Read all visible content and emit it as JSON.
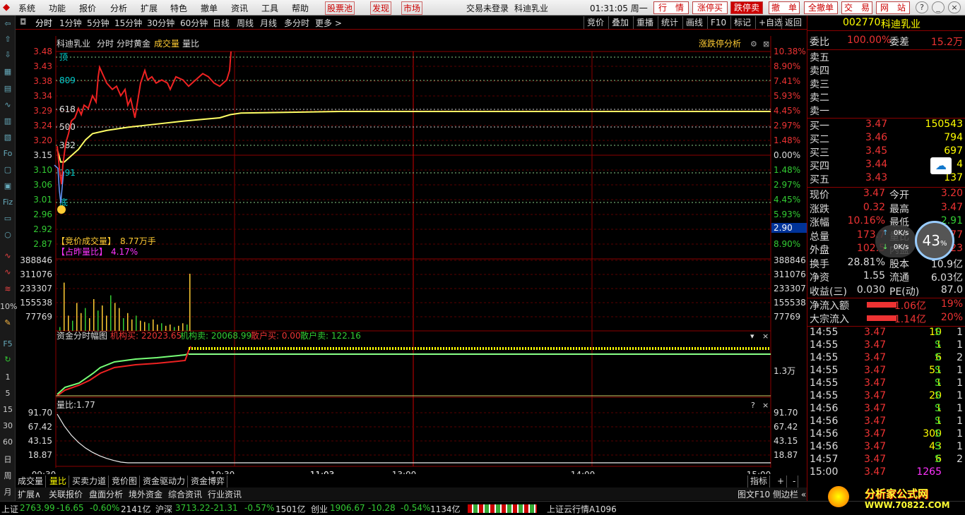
{
  "menu": [
    "系统",
    "功能",
    "报价",
    "分析",
    "扩展",
    "特色",
    "撤单",
    "资讯",
    "工具",
    "帮助"
  ],
  "menu_extra": {
    "pool": "股票池",
    "find": "发现",
    "market": "市场",
    "login": "交易未登录",
    "stock": "科迪乳业",
    "clock": "01:31:05 周一"
  },
  "top_buttons": [
    "行　情",
    "涨停买",
    "跌停卖",
    "撤　单",
    "全撤单",
    "交　易",
    "网　站"
  ],
  "win_buttons": [
    "?",
    "_",
    "□",
    "×"
  ],
  "period_tabs": [
    "分时",
    "1分钟",
    "5分钟",
    "15分钟",
    "30分钟",
    "60分钟",
    "日线",
    "周线",
    "月线",
    "多分时",
    "更多 >"
  ],
  "right_tabs": [
    "竞价",
    "叠加",
    "重播",
    "统计",
    "画线",
    "F10",
    "标记",
    "+自选",
    "返回"
  ],
  "header": {
    "name": "科迪乳业",
    "t1": "分时",
    "t2": "分时黄金",
    "t3": "成交量",
    "t4": "量比",
    "analysis": "涨跌停分析"
  },
  "left_tools": [
    "Fo",
    "Fiz",
    "10%",
    "F5",
    "1",
    "5",
    "15",
    "30",
    "60",
    "日",
    "周",
    "月"
  ],
  "price_axis": {
    "left": [
      "3.48",
      "3.43",
      "3.38",
      "3.34",
      "3.29",
      "3.24",
      "3.20",
      "3.15",
      "3.10",
      "3.06",
      "3.01",
      "2.96",
      "2.92",
      "2.87"
    ],
    "right": [
      "10.38%",
      "8.90%",
      "7.41%",
      "5.93%",
      "4.45%",
      "2.97%",
      "1.48%",
      "0.00%",
      "1.48%",
      "2.97%",
      "4.45%",
      "5.93%",
      "7.41%",
      "8.90%"
    ],
    "cursor": "2.90"
  },
  "price_labels": [
    "顶",
    "809",
    "618",
    "500",
    "382",
    "191",
    "底"
  ],
  "auction": {
    "l1": "【竞价成交量】",
    "v1": "8.77万手",
    "l2": "【占昨量比】",
    "v2": "4.17%"
  },
  "vol_axis": [
    "388846",
    "311076",
    "233307",
    "155538",
    "77769"
  ],
  "fund": {
    "title": "资金分时幅图",
    "a": "机构买: 22023.65",
    "b": "机构卖: 20068.99",
    "c": "散户买: 0.00",
    "d": "散户卖: 122.16",
    "unit": "1.3万"
  },
  "ratio": {
    "title": "量比:1.77",
    "axis": [
      "91.70",
      "67.42",
      "43.15",
      "18.87"
    ]
  },
  "time_axis": [
    "09:30",
    "10:30",
    "11:03",
    "13:00",
    "14:00",
    "15:00"
  ],
  "bottom_tabs": [
    "成交量",
    "量比",
    "买卖力道",
    "竞价图",
    "资金驱动力",
    "资金博弈"
  ],
  "bottom_right": [
    "指标",
    "+",
    "-"
  ],
  "bottom_tabs2": [
    "扩展∧",
    "关联报价",
    "盘面分析",
    "境外资金",
    "综合资讯",
    "行业资讯"
  ],
  "bottom_right2": [
    "图文F10",
    "侧边栏 «",
    "笔"
  ],
  "quote": {
    "code": "002770",
    "name": "科迪乳业",
    "wb": "委比",
    "wbv": "100.00%",
    "wc": "委差",
    "wcv": "15.2万",
    "sells": [
      "卖五",
      "卖四",
      "卖三",
      "卖二",
      "卖一"
    ],
    "buys": [
      [
        "买一",
        "3.47",
        "150543"
      ],
      [
        "买二",
        "3.46",
        "794"
      ],
      [
        "买三",
        "3.45",
        "697"
      ],
      [
        "买四",
        "3.44",
        "4"
      ],
      [
        "买五",
        "3.43",
        "137"
      ]
    ],
    "stats": [
      [
        "现价",
        "3.47",
        "今开",
        "3.20"
      ],
      [
        "涨跌",
        "0.32",
        "最高",
        "3.47"
      ],
      [
        "涨幅",
        "10.16%",
        "最低",
        "2.91"
      ],
      [
        "总量",
        "173.7",
        "量比",
        "77"
      ],
      [
        "外盘",
        "102.5",
        "内盘",
        "23"
      ],
      [
        "换手",
        "28.81%",
        "股本",
        "10.9亿"
      ],
      [
        "净资",
        "1.55",
        "流通",
        "6.03亿"
      ],
      [
        "收益(三)",
        "0.030",
        "PE(动)",
        "87.0"
      ]
    ],
    "flows": [
      [
        "净流入额",
        "1.06亿",
        "19%"
      ],
      [
        "大宗流入",
        "1.14亿",
        "20%"
      ]
    ],
    "net": {
      "up": "0K/s",
      "down": "0K/s",
      "pct": "43"
    },
    "ticks": [
      [
        "14:55",
        "3.47",
        "10",
        "S",
        "1"
      ],
      [
        "14:55",
        "3.47",
        "1",
        "S",
        "1"
      ],
      [
        "14:55",
        "3.47",
        "6",
        "S",
        "2"
      ],
      [
        "14:55",
        "3.47",
        "51",
        "S",
        "1"
      ],
      [
        "14:55",
        "3.47",
        "1",
        "S",
        "1"
      ],
      [
        "14:55",
        "3.47",
        "20",
        "S",
        "1"
      ],
      [
        "14:56",
        "3.47",
        "1",
        "S",
        "1"
      ],
      [
        "14:56",
        "3.47",
        "1",
        "S",
        "1"
      ],
      [
        "14:56",
        "3.47",
        "300",
        "S",
        "1"
      ],
      [
        "14:56",
        "3.47",
        "43",
        "S",
        "1"
      ],
      [
        "14:57",
        "3.47",
        "6",
        "S",
        "2"
      ],
      [
        "15:00",
        "3.47",
        "1265",
        "",
        ""
      ]
    ]
  },
  "status": {
    "sh": "上证",
    "sh_v": "2763.99",
    "sh_c": "-16.65",
    "sh_p": "-0.60%",
    "sh_a": "2141亿",
    "hs": "沪深",
    "hs_v": "3713.22",
    "hs_c": "-21.31",
    "hs_p": "-0.57%",
    "hs_a": "1501亿",
    "cy": "创业",
    "cy_v": "1906.67",
    "cy_c": "-10.28",
    "cy_p": "-0.54%",
    "cy_a": "1134亿",
    "cloud": "上证云行情A1096",
    "logo1": "分析家公式网",
    "logo2": "WWW.70822.COM"
  },
  "colors": {
    "red": "#e33",
    "green": "#3c3",
    "yellow": "#ff0",
    "grid": "#8b0000"
  }
}
